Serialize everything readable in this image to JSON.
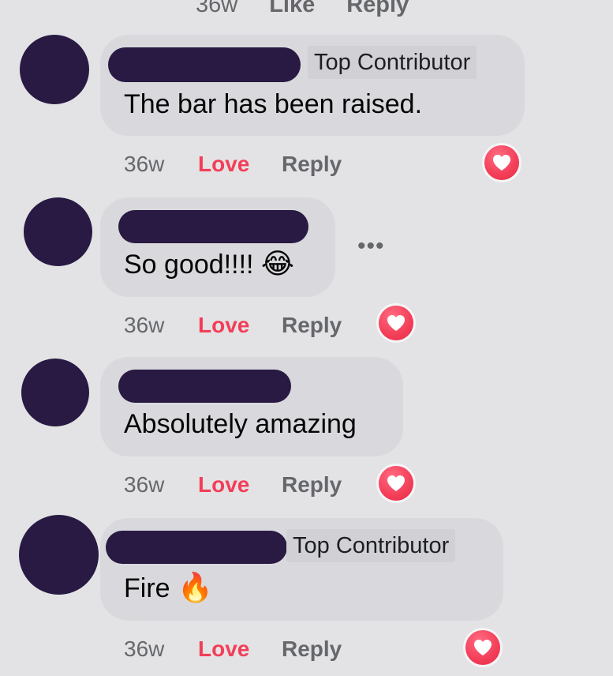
{
  "previous_comment": {
    "time": "36w",
    "like_label": "Like",
    "reply_label": "Reply"
  },
  "comments": [
    {
      "badge": "Top Contributor",
      "text": "The bar has been raised.",
      "time": "36w",
      "love_label": "Love",
      "reply_label": "Reply",
      "reaction": "heart-icon"
    },
    {
      "text": "So good!!!!",
      "emoji": "😂",
      "time": "36w",
      "love_label": "Love",
      "reply_label": "Reply",
      "reaction": "heart-icon",
      "more_label": "•••"
    },
    {
      "text": "Absolutely amazing",
      "time": "36w",
      "love_label": "Love",
      "reply_label": "Reply",
      "reaction": "heart-icon"
    },
    {
      "badge": "Top Contributor",
      "text": "Fire",
      "emoji": "🔥",
      "time": "36w",
      "love_label": "Love",
      "reply_label": "Reply",
      "reaction": "heart-icon"
    }
  ],
  "colors": {
    "avatar": "#281a43",
    "love": "#f33e58",
    "secondary_text": "#65676b",
    "bubble": "#d9d9dd"
  }
}
